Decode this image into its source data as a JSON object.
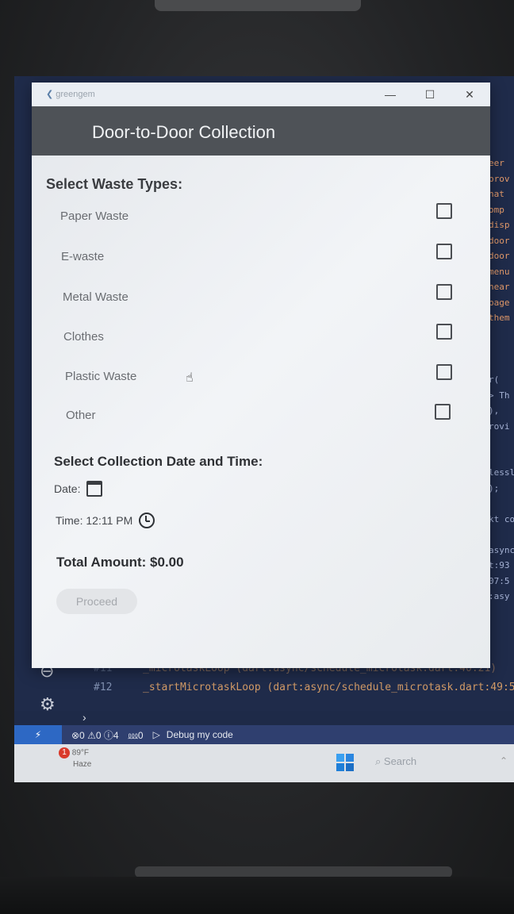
{
  "window": {
    "app_name": "greengem",
    "minimize_label": "—",
    "maximize_label": "☐",
    "close_label": "✕"
  },
  "header": {
    "title": "Door-to-Door Collection"
  },
  "waste_section": {
    "title": "Select Waste Types:",
    "items": [
      {
        "label": "Paper Waste",
        "checked": false
      },
      {
        "label": "E-waste",
        "checked": false
      },
      {
        "label": "Metal Waste",
        "checked": false
      },
      {
        "label": "Clothes",
        "checked": false
      },
      {
        "label": "Plastic Waste",
        "checked": false
      },
      {
        "label": "Other",
        "checked": false
      }
    ]
  },
  "collection": {
    "title": "Select Collection Date and Time:",
    "date_label": "Date:",
    "time_label": "Time: 12:11 PM"
  },
  "total": {
    "label": "Total Amount: $0.00"
  },
  "proceed": {
    "label": "Proceed",
    "enabled": false
  },
  "background_code": {
    "right_fragments": [
      "eer",
      "prov",
      "hat",
      "omp",
      "disp",
      "door",
      "door",
      "menu",
      "hear",
      "page",
      "them",
      "",
      "",
      "",
      "r(",
      "> Th",
      "),",
      "rovi",
      "",
      "",
      "lessl",
      ");",
      "",
      "kt co",
      "",
      "async",
      "t:93",
      "07:5",
      ":asy"
    ],
    "lines": [
      {
        "num": "#11",
        "text": "_microtaskLoop (dart:async/schedule_microtask.dart:40:21)"
      },
      {
        "num": "#12",
        "text": "_startMicrotaskLoop (dart:async/schedule_microtask.dart:49:5"
      }
    ]
  },
  "status_bar": {
    "problems": "⊗0 ⚠0 ⓘ4",
    "ports": "⅏0",
    "debug": "Debug my code"
  },
  "taskbar": {
    "weather_temp": "89°F",
    "weather_cond": "Haze",
    "notification_count": "1",
    "search_placeholder": "Search"
  }
}
